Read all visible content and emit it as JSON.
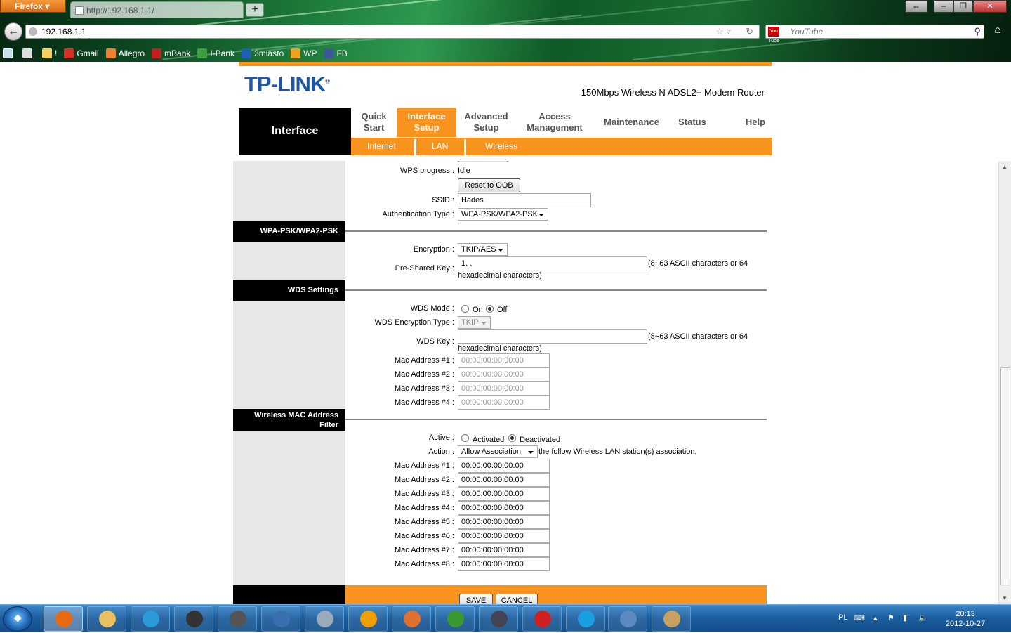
{
  "browser": {
    "app_button": "Firefox",
    "tab_title": "http://192.168.1.1/",
    "new_tab": "+",
    "url": "192.168.1.1",
    "search_placeholder": "YouTube",
    "search_engine_badge": "You Tube",
    "bookmarks": [
      {
        "label": "!",
        "icon": "folder-icon",
        "color": "#f4d060"
      },
      {
        "label": "Gmail",
        "icon": "gmail-icon",
        "color": "#d93025"
      },
      {
        "label": "Allegro",
        "icon": "allegro-icon",
        "color": "#f08030"
      },
      {
        "label": "mBank",
        "icon": "mbank-icon",
        "color": "#c02020"
      },
      {
        "label": "I-Bank",
        "icon": "ibank-icon",
        "color": "#40a040"
      },
      {
        "label": "3miasto",
        "icon": "3miasto-icon",
        "color": "#2060b0"
      },
      {
        "label": "WP",
        "icon": "rss-icon",
        "color": "#f0a020"
      },
      {
        "label": "FB",
        "icon": "facebook-icon",
        "color": "#3b5998"
      }
    ]
  },
  "router": {
    "brand": "TP-LINK",
    "brand_reg": "®",
    "model": "150Mbps Wireless N ADSL2+ Modem Router",
    "current_section": "Interface",
    "nav": [
      {
        "label_l1": "Quick",
        "label_l2": "Start"
      },
      {
        "label_l1": "Interface",
        "label_l2": "Setup"
      },
      {
        "label_l1": "Advanced",
        "label_l2": "Setup"
      },
      {
        "label_l1": "Access",
        "label_l2": "Management"
      },
      {
        "label": "Maintenance"
      },
      {
        "label": "Status"
      },
      {
        "label": "Help"
      }
    ],
    "subnav": [
      "Internet",
      "LAN",
      "Wireless"
    ]
  },
  "form": {
    "wps_progress_label": "WPS progress :",
    "wps_progress_value": "Idle",
    "reset_oob": "Reset to OOB",
    "ssid_label": "SSID :",
    "ssid_value": "Hades",
    "auth_label": "Authentication Type :",
    "auth_value": "WPA-PSK/WPA2-PSK",
    "wpa_section": "WPA-PSK/WPA2-PSK",
    "encryption_label": "Encryption :",
    "encryption_value": "TKIP/AES",
    "psk_label": "Pre-Shared Key :",
    "psk_value": "1.      .",
    "psk_hint": "(8~63 ASCII characters or 64",
    "psk_hint2": "hexadecimal characters)",
    "wds_section": "WDS Settings",
    "wds_mode_label": "WDS Mode :",
    "wds_on": "On",
    "wds_off": "Off",
    "wds_enc_label": "WDS Encryption Type :",
    "wds_enc_value": "TKIP",
    "wds_key_label": "WDS Key :",
    "wds_key_hint": "(8~63 ASCII characters or 64",
    "wds_key_hint2": "hexadecimal characters)",
    "wds_mac_label_1": "Mac Address #1 :",
    "wds_mac_label_2": "Mac Address #2 :",
    "wds_mac_label_3": "Mac Address #3 :",
    "wds_mac_label_4": "Mac Address #4 :",
    "mac_default": "00:00:00:00:00:00",
    "mac_filter_section_l1": "Wireless MAC Address",
    "mac_filter_section_l2": "Filter",
    "active_label": "Active :",
    "activated": "Activated",
    "deactivated": "Deactivated",
    "action_label": "Action :",
    "action_value": "Allow Association",
    "action_suffix": "the follow Wireless LAN station(s) association.",
    "filter_mac_labels": [
      "Mac Address #1 :",
      "Mac Address #2 :",
      "Mac Address #3 :",
      "Mac Address #4 :",
      "Mac Address #5 :",
      "Mac Address #6 :",
      "Mac Address #7 :",
      "Mac Address #8 :"
    ],
    "save": "SAVE",
    "cancel": "CANCEL"
  },
  "taskbar": {
    "language": "PL",
    "time": "20:13",
    "date": "2012-10-27",
    "apps": [
      {
        "name": "firefox-icon",
        "color": "#e86a10"
      },
      {
        "name": "explorer-icon",
        "color": "#e8c060"
      },
      {
        "name": "ie-icon",
        "color": "#2a9ad8"
      },
      {
        "name": "hp-icon",
        "color": "#333"
      },
      {
        "name": "movie-maker-icon",
        "color": "#555"
      },
      {
        "name": "remote-desktop-icon",
        "color": "#3a70b0"
      },
      {
        "name": "calculator-icon",
        "color": "#9ab"
      },
      {
        "name": "avast-icon",
        "color": "#f0a000"
      },
      {
        "name": "paint-brush-icon",
        "color": "#e07030"
      },
      {
        "name": "utorrent-icon",
        "color": "#3a9a30"
      },
      {
        "name": "game-icon",
        "color": "#445"
      },
      {
        "name": "app13-icon",
        "color": "#d02020"
      },
      {
        "name": "skype-icon",
        "color": "#1aa0e0"
      },
      {
        "name": "control-panel-icon",
        "color": "#5a8ac0"
      },
      {
        "name": "paint-icon",
        "color": "#c8a060"
      }
    ]
  }
}
